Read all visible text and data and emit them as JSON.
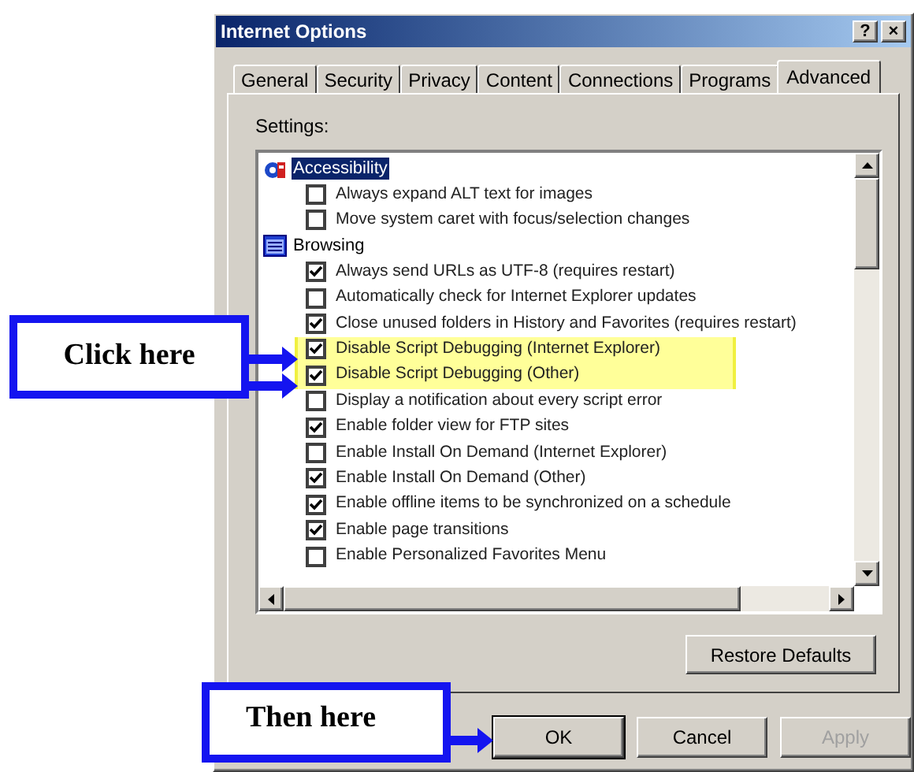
{
  "window": {
    "title": "Internet Options",
    "buttons": [
      "?",
      "×"
    ]
  },
  "tabs": [
    {
      "label": "General",
      "selected": false
    },
    {
      "label": "Security",
      "selected": false
    },
    {
      "label": "Privacy",
      "selected": false
    },
    {
      "label": "Content",
      "selected": false
    },
    {
      "label": "Connections",
      "selected": false
    },
    {
      "label": "Programs",
      "selected": false
    },
    {
      "label": "Advanced",
      "selected": true
    }
  ],
  "settings": {
    "label": "Settings:",
    "categories": [
      {
        "label": "Accessibility",
        "kind": "accessibility",
        "selected": true,
        "children": [
          {
            "label": "Always expand ALT text for images",
            "checked": false,
            "highlighted": false
          },
          {
            "label": "Move system caret with focus/selection changes",
            "checked": false,
            "highlighted": false
          }
        ]
      },
      {
        "label": "Browsing",
        "kind": "browsing",
        "selected": false,
        "children": [
          {
            "label": "Always send URLs as UTF-8 (requires restart)",
            "checked": true,
            "highlighted": false
          },
          {
            "label": "Automatically check for Internet Explorer updates",
            "checked": false,
            "highlighted": false
          },
          {
            "label": "Close unused folders in History and Favorites (requires restart)",
            "checked": true,
            "highlighted": false
          },
          {
            "label": "Disable Script Debugging (Internet Explorer)",
            "checked": true,
            "highlighted": true
          },
          {
            "label": "Disable Script Debugging (Other)",
            "checked": true,
            "highlighted": true
          },
          {
            "label": "Display a notification about every script error",
            "checked": false,
            "highlighted": false
          },
          {
            "label": "Enable folder view for FTP sites",
            "checked": true,
            "highlighted": false
          },
          {
            "label": "Enable Install On Demand (Internet Explorer)",
            "checked": false,
            "highlighted": false
          },
          {
            "label": "Enable Install On Demand (Other)",
            "checked": true,
            "highlighted": false
          },
          {
            "label": "Enable offline items to be synchronized on a schedule",
            "checked": true,
            "highlighted": false
          },
          {
            "label": "Enable page transitions",
            "checked": true,
            "highlighted": false
          },
          {
            "label": "Enable Personalized Favorites Menu",
            "checked": false,
            "highlighted": false
          }
        ]
      }
    ]
  },
  "restore_button": "Restore Defaults",
  "buttons": [
    {
      "label": "OK",
      "disabled": false
    },
    {
      "label": "Cancel",
      "disabled": false
    },
    {
      "label": "Apply",
      "disabled": true
    }
  ],
  "callouts": [
    {
      "text": "Click here",
      "kind": "double"
    },
    {
      "text": "Then here",
      "kind": "single"
    }
  ]
}
